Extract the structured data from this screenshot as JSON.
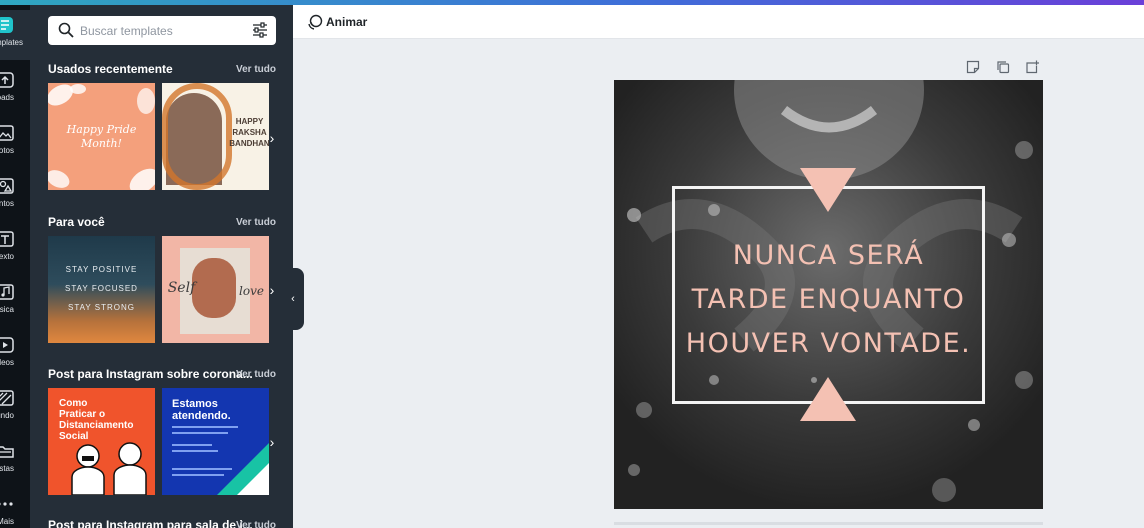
{
  "rail": {
    "items": [
      {
        "label": "Templates",
        "icon": "templates-icon"
      },
      {
        "label": "Uploads",
        "icon": "upload-icon"
      },
      {
        "label": "Fotos",
        "icon": "photo-icon"
      },
      {
        "label": "Elementos",
        "icon": "elements-icon"
      },
      {
        "label": "Texto",
        "icon": "text-icon"
      },
      {
        "label": "Música",
        "icon": "music-icon"
      },
      {
        "label": "Vídeos",
        "icon": "video-icon"
      },
      {
        "label": "Fundo",
        "icon": "background-icon"
      },
      {
        "label": "Pastas",
        "icon": "folder-icon"
      },
      {
        "label": "Mais",
        "icon": "more-icon"
      }
    ]
  },
  "search": {
    "placeholder": "Buscar templates"
  },
  "sections": [
    {
      "title": "Usados recentemente",
      "see_all": "Ver tudo"
    },
    {
      "title": "Para você",
      "see_all": "Ver tudo"
    },
    {
      "title": "Post para Instagram sobre corona...",
      "see_all": "Ver tudo"
    },
    {
      "title": "Post para Instagram para sala de i...",
      "see_all": "Ver tudo"
    }
  ],
  "thumbs": {
    "pride": {
      "line1": "Happy Pride",
      "line2": "Month!"
    },
    "raksha": {
      "line1": "HAPPY",
      "line2": "RAKSHA",
      "line3": "BANDHAN"
    },
    "stay": {
      "line1": "STAY POSITIVE",
      "line2": "STAY FOCUSED",
      "line3": "STAY STRONG"
    },
    "self": {
      "line1": "Self",
      "line2": "love"
    },
    "distanc": {
      "line1": "Como",
      "line2": "Praticar o",
      "line3": "Distanciamento",
      "line4": "Social"
    },
    "atend": {
      "line1": "Estamos",
      "line2": "atendendo."
    }
  },
  "topbar": {
    "animate_label": "Animar"
  },
  "canvas": {
    "quote_lines": [
      "NUNCA SERÁ",
      "TARDE ENQUANTO",
      "HOUVER VONTADE."
    ],
    "accent_color": "#f4c1b3"
  },
  "colors": {
    "rail_bg": "#0e1318",
    "panel_bg": "#252e38",
    "workspace_bg": "#ebeef2"
  }
}
